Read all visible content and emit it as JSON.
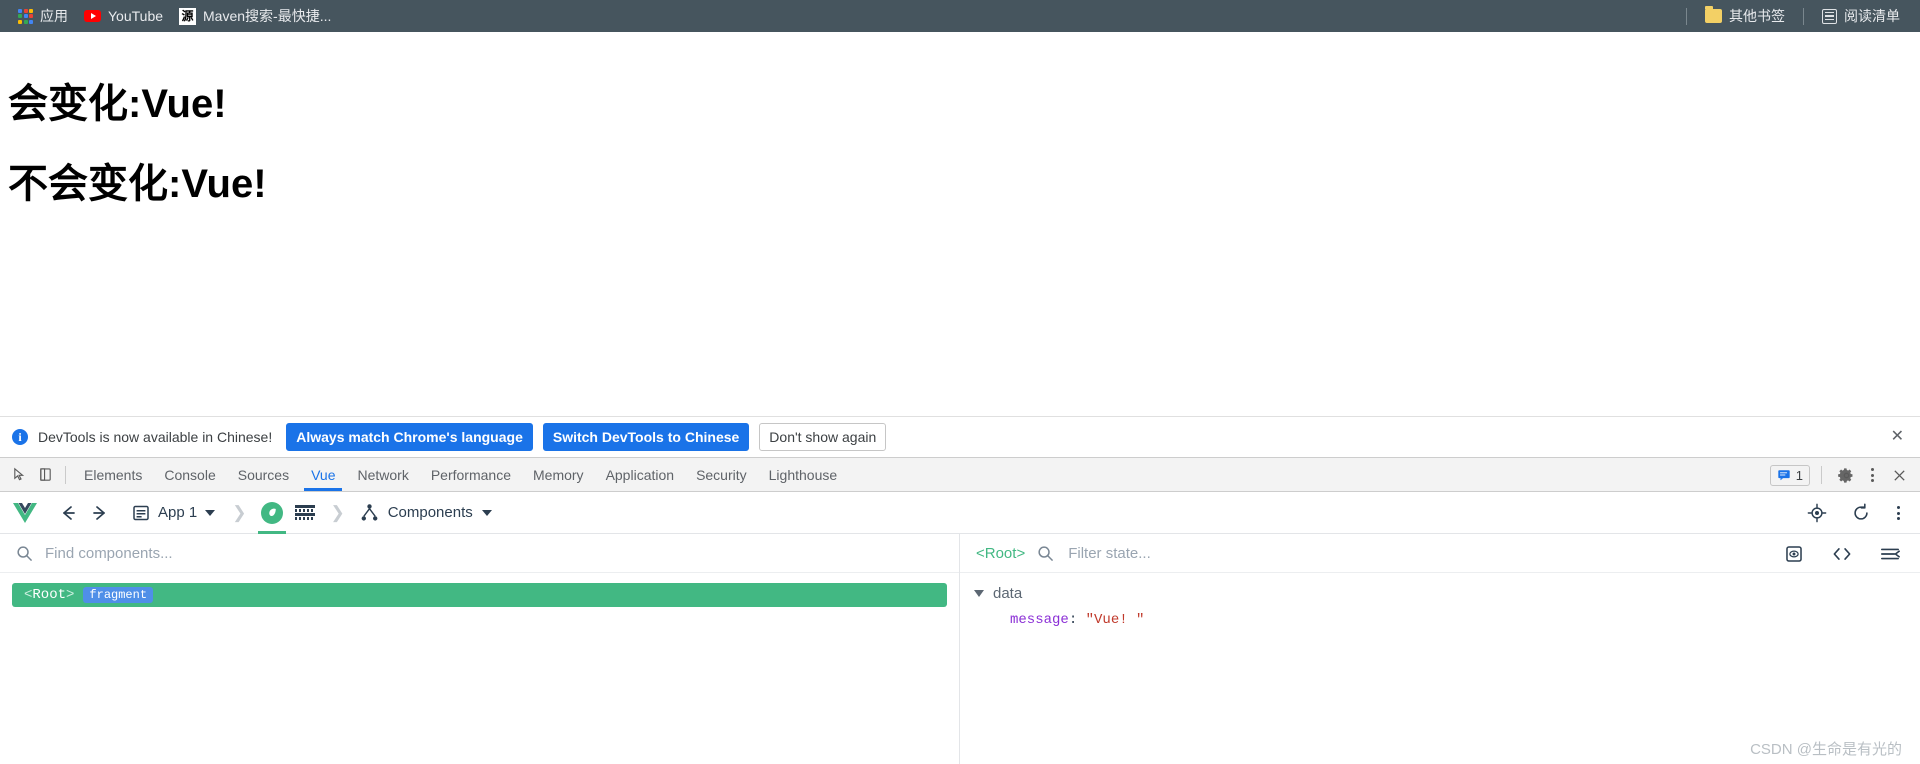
{
  "browser": {
    "bookmarks": [
      {
        "label": "应用",
        "icon": "apps-grid-icon"
      },
      {
        "label": "YouTube",
        "icon": "youtube-icon"
      },
      {
        "label": "Maven搜索-最快捷...",
        "icon": "maven-icon",
        "glyph": "源"
      }
    ],
    "right_items": [
      {
        "label": "其他书签",
        "icon": "folder-icon"
      },
      {
        "label": "阅读清单",
        "icon": "reading-list-icon"
      }
    ]
  },
  "page": {
    "heading_one": "会变化:Vue!",
    "heading_two": "不会变化:Vue!"
  },
  "notification": {
    "icon": "info-icon",
    "message": "DevTools is now available in Chinese!",
    "primary_button": "Always match Chrome's language",
    "secondary_button": "Switch DevTools to Chinese",
    "dismiss_button": "Don't show again",
    "close_icon": "close-icon"
  },
  "devtools": {
    "tabs": [
      {
        "label": "Elements",
        "active": false
      },
      {
        "label": "Console",
        "active": false
      },
      {
        "label": "Sources",
        "active": false
      },
      {
        "label": "Vue",
        "active": true
      },
      {
        "label": "Network",
        "active": false
      },
      {
        "label": "Performance",
        "active": false
      },
      {
        "label": "Memory",
        "active": false
      },
      {
        "label": "Application",
        "active": false
      },
      {
        "label": "Security",
        "active": false
      },
      {
        "label": "Lighthouse",
        "active": false
      }
    ],
    "message_count": "1",
    "accent_color": "#1a73e8",
    "left_icons": [
      "inspect-element-icon",
      "device-toolbar-icon"
    ],
    "right_icons": [
      "messages-icon",
      "settings-gear-icon",
      "more-options-icon",
      "close-devtools-icon"
    ]
  },
  "vue_toolbar": {
    "logo": "vue-logo-icon",
    "back_icon": "back-arrow-icon",
    "forward_icon": "forward-arrow-icon",
    "app_label": "App 1",
    "app_icon": "app-document-icon",
    "instance_icon": "vue-instance-icon",
    "grid_icon": "grid-view-icon",
    "panel_label": "Components",
    "panel_icon": "component-tree-icon",
    "right_icons": [
      "target-select-icon",
      "refresh-icon",
      "more-options-icon"
    ],
    "accent_color": "#42b883"
  },
  "component_tree": {
    "search_placeholder": "Find components...",
    "search_value": "",
    "search_icon": "search-icon",
    "nodes": [
      {
        "name": "Root",
        "tag": "fragment",
        "selected": true
      }
    ]
  },
  "state_panel": {
    "selected_component": "<Root>",
    "filter_placeholder": "Filter state...",
    "filter_value": "",
    "search_icon": "search-icon",
    "right_icons": [
      "inspect-dom-icon",
      "open-in-editor-icon",
      "collapse-all-icon"
    ],
    "groups": [
      {
        "label": "data",
        "expanded": true,
        "entries": [
          {
            "key": "message",
            "separator": ":",
            "value": "\"Vue! \""
          }
        ]
      }
    ]
  },
  "watermark": "CSDN @生命是有光的",
  "colors": {
    "bookmark_bar_bg": "#46555e",
    "vue_green": "#42b883",
    "devtools_blue": "#1a73e8",
    "tag_blue": "#4f8fe8",
    "string_red": "#c0392b",
    "key_purple": "#8b2fd6"
  }
}
